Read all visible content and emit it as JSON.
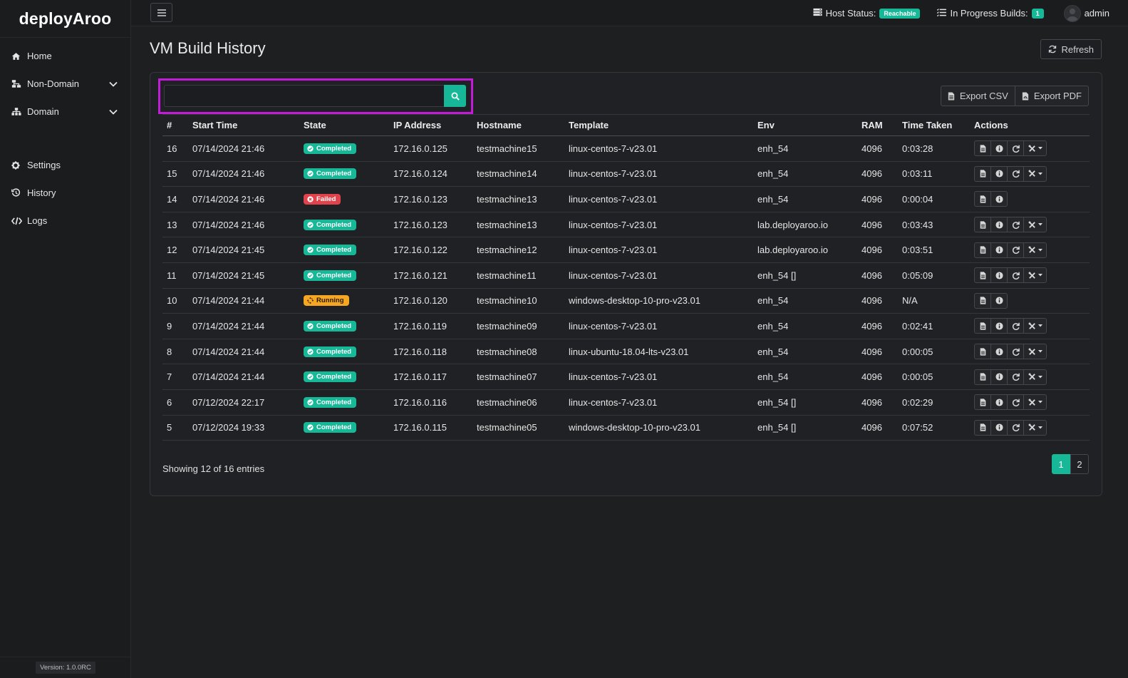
{
  "app": {
    "logo": "deployAroo",
    "version": "Version: 1.0.0RC"
  },
  "sidebar": {
    "items": [
      {
        "label": "Home",
        "icon": "home-icon"
      },
      {
        "label": "Non-Domain",
        "icon": "network-icon"
      },
      {
        "label": "Domain",
        "icon": "sitemap-icon"
      },
      {
        "label": "Settings",
        "icon": "gear-icon"
      },
      {
        "label": "History",
        "icon": "history-icon"
      },
      {
        "label": "Logs",
        "icon": "code-icon"
      }
    ]
  },
  "topbar": {
    "host_status_label": "Host Status:",
    "host_status_value": "Reachable",
    "builds_label": "In Progress Builds:",
    "builds_count": "1",
    "user": "admin"
  },
  "page": {
    "title": "VM Build History",
    "refresh_label": "Refresh"
  },
  "toolbar": {
    "search_placeholder": "",
    "export_csv": "Export CSV",
    "export_pdf": "Export PDF"
  },
  "table": {
    "headers": [
      "#",
      "Start Time",
      "State",
      "IP Address",
      "Hostname",
      "Template",
      "Env",
      "RAM",
      "Time Taken",
      "Actions"
    ],
    "rows": [
      {
        "id": "16",
        "start": "07/14/2024 21:46",
        "state": "Completed",
        "ip": "172.16.0.125",
        "host": "testmachine15",
        "template": "linux-centos-7-v23.01",
        "env": "enh_54",
        "ram": "4096",
        "time": "0:03:28"
      },
      {
        "id": "15",
        "start": "07/14/2024 21:46",
        "state": "Completed",
        "ip": "172.16.0.124",
        "host": "testmachine14",
        "template": "linux-centos-7-v23.01",
        "env": "enh_54",
        "ram": "4096",
        "time": "0:03:11"
      },
      {
        "id": "14",
        "start": "07/14/2024 21:46",
        "state": "Failed",
        "ip": "172.16.0.123",
        "host": "testmachine13",
        "template": "linux-centos-7-v23.01",
        "env": "enh_54",
        "ram": "4096",
        "time": "0:00:04"
      },
      {
        "id": "13",
        "start": "07/14/2024 21:46",
        "state": "Completed",
        "ip": "172.16.0.123",
        "host": "testmachine13",
        "template": "linux-centos-7-v23.01",
        "env": "lab.deployaroo.io",
        "ram": "4096",
        "time": "0:03:43"
      },
      {
        "id": "12",
        "start": "07/14/2024 21:45",
        "state": "Completed",
        "ip": "172.16.0.122",
        "host": "testmachine12",
        "template": "linux-centos-7-v23.01",
        "env": "lab.deployaroo.io",
        "ram": "4096",
        "time": "0:03:51"
      },
      {
        "id": "11",
        "start": "07/14/2024 21:45",
        "state": "Completed",
        "ip": "172.16.0.121",
        "host": "testmachine11",
        "template": "linux-centos-7-v23.01",
        "env": "enh_54 []",
        "ram": "4096",
        "time": "0:05:09"
      },
      {
        "id": "10",
        "start": "07/14/2024 21:44",
        "state": "Running",
        "ip": "172.16.0.120",
        "host": "testmachine10",
        "template": "windows-desktop-10-pro-v23.01",
        "env": "enh_54",
        "ram": "4096",
        "time": "N/A"
      },
      {
        "id": "9",
        "start": "07/14/2024 21:44",
        "state": "Completed",
        "ip": "172.16.0.119",
        "host": "testmachine09",
        "template": "linux-centos-7-v23.01",
        "env": "enh_54",
        "ram": "4096",
        "time": "0:02:41"
      },
      {
        "id": "8",
        "start": "07/14/2024 21:44",
        "state": "Completed",
        "ip": "172.16.0.118",
        "host": "testmachine08",
        "template": "linux-ubuntu-18.04-lts-v23.01",
        "env": "enh_54",
        "ram": "4096",
        "time": "0:00:05"
      },
      {
        "id": "7",
        "start": "07/14/2024 21:44",
        "state": "Completed",
        "ip": "172.16.0.117",
        "host": "testmachine07",
        "template": "linux-centos-7-v23.01",
        "env": "enh_54",
        "ram": "4096",
        "time": "0:00:05"
      },
      {
        "id": "6",
        "start": "07/12/2024 22:17",
        "state": "Completed",
        "ip": "172.16.0.116",
        "host": "testmachine06",
        "template": "linux-centos-7-v23.01",
        "env": "enh_54 []",
        "ram": "4096",
        "time": "0:02:29"
      },
      {
        "id": "5",
        "start": "07/12/2024 19:33",
        "state": "Completed",
        "ip": "172.16.0.115",
        "host": "testmachine05",
        "template": "windows-desktop-10-pro-v23.01",
        "env": "enh_54 []",
        "ram": "4096",
        "time": "0:07:52"
      }
    ]
  },
  "footer": {
    "entries": "Showing 12 of 16 entries",
    "pages": [
      "1",
      "2"
    ],
    "current_page": "1"
  },
  "colors": {
    "accent": "#17b897",
    "failed": "#e0434b",
    "running": "#f5a623",
    "highlight": "#c41bd9"
  }
}
